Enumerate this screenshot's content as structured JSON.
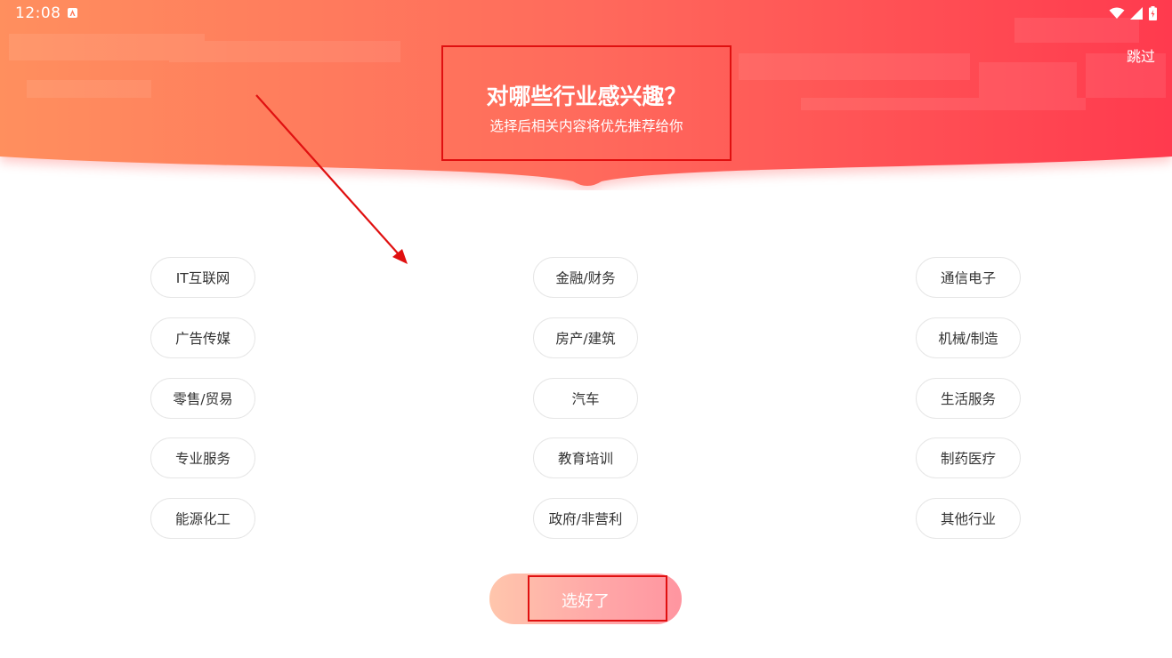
{
  "status_bar": {
    "time": "12:08",
    "app_icon": "notification-app-icon",
    "icons": [
      "wifi-icon",
      "signal-icon",
      "battery-icon"
    ]
  },
  "header": {
    "skip_label": "跳过",
    "title": "对哪些行业感兴趣？",
    "subtitle": "选择后相关内容将优先推荐给你",
    "gradient_start": "#ff8a5a",
    "gradient_end": "#ff3a4e"
  },
  "industries": [
    [
      "IT互联网",
      "金融/财务",
      "通信电子"
    ],
    [
      "广告传媒",
      "房产/建筑",
      "机械/制造"
    ],
    [
      "零售/贸易",
      "汽车",
      "生活服务"
    ],
    [
      "专业服务",
      "教育培训",
      "制药医疗"
    ],
    [
      "能源化工",
      "政府/非营利",
      "其他行业"
    ]
  ],
  "done_button": {
    "label": "选好了"
  },
  "annotation_color": "#e01010"
}
